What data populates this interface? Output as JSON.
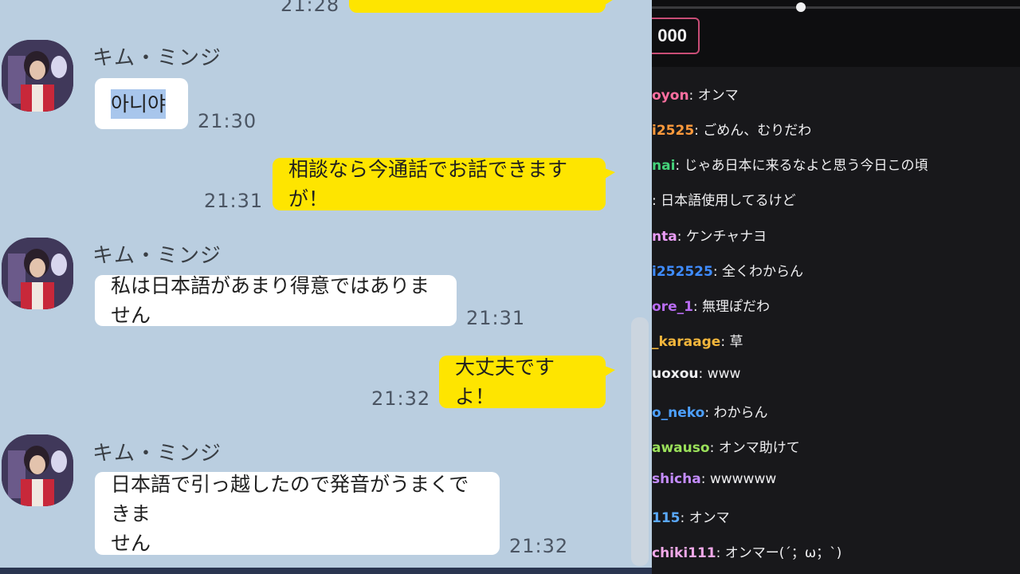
{
  "messenger": {
    "top_time": "21:28",
    "messages": [
      {
        "sender": "キム・ミンジ",
        "text": "아니야",
        "time": "21:30",
        "dir": "in"
      },
      {
        "text": "相談なら今通話でお話できますが！",
        "time": "21:31",
        "dir": "out"
      },
      {
        "sender": "キム・ミンジ",
        "text": "私は日本語があまり得意ではありません",
        "time": "21:31",
        "dir": "in"
      },
      {
        "text": "大丈夫ですよ！",
        "time": "21:32",
        "dir": "out"
      },
      {
        "sender": "キム・ミンジ",
        "text_line1": "日本語で引っ越したので発音がうまくできま",
        "text_line2": "せん",
        "time": "21:32",
        "dir": "in"
      }
    ],
    "colors": {
      "background": "#bacee0",
      "outgoing": "#fee500",
      "incoming": "#ffffff"
    }
  },
  "stream_chat": {
    "points_value": "000",
    "messages": [
      {
        "user": "oyon",
        "text": ": オンマ",
        "color": "#ff6fa0"
      },
      {
        "user": "i2525",
        "text": ": ごめん、むりだわ",
        "color": "#ff9a3c"
      },
      {
        "user": "nai",
        "text": ": じゃあ日本に来るなよと思う今日この頃",
        "color": "#44d27a"
      },
      {
        "user": "",
        "text": ": 日本語使用してるけど",
        "color": "#9a9aa0"
      },
      {
        "user": "nta",
        "text": ": ケンチャナヨ",
        "color": "#e99cf5"
      },
      {
        "user": "i252525",
        "text": ": 全くわからん",
        "color": "#3f8cff"
      },
      {
        "user": "ore_1",
        "text": ": 無理ぽだわ",
        "color": "#b86cf2"
      },
      {
        "user": "_karaage",
        "text": ": 草",
        "color": "#f2b63c"
      },
      {
        "user": "uoxou",
        "text": ": www",
        "color": "#efeff1"
      },
      {
        "user": "o_neko",
        "text": ": わからん",
        "color": "#4da0ff"
      },
      {
        "user": "awauso",
        "text": ": オンマ助けて",
        "color": "#9ae05a"
      },
      {
        "user": "shicha",
        "text": ": wwwwww",
        "color": "#c48cff"
      },
      {
        "user": "115",
        "text": ": オンマ",
        "color": "#5aa9ff"
      },
      {
        "user": "chiki111",
        "text": ": オンマー(´；ω；`)",
        "color": "#f0a8e8"
      }
    ]
  }
}
